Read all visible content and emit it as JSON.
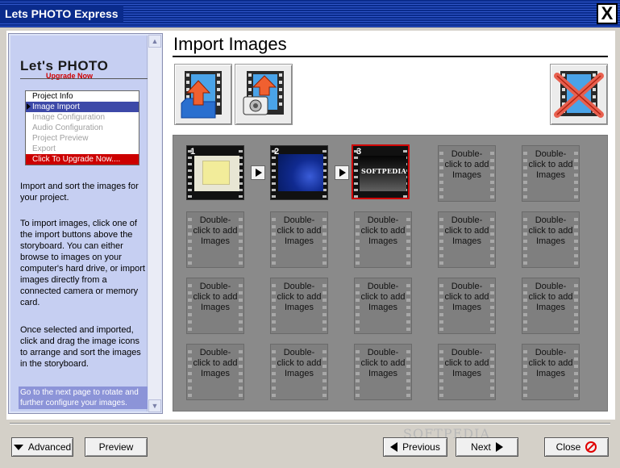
{
  "window": {
    "title": "Lets PHOTO Express",
    "close_glyph": "X"
  },
  "sidebar": {
    "logo_main": "Let's PHOTO",
    "logo_sub": "Upgrade Now",
    "nav": [
      {
        "label": "Project Info",
        "state": "head"
      },
      {
        "label": "Image Import",
        "state": "active"
      },
      {
        "label": "Image Configuration",
        "state": "disabled"
      },
      {
        "label": "Audio Configuration",
        "state": "disabled"
      },
      {
        "label": "Project Preview",
        "state": "disabled"
      },
      {
        "label": "Export",
        "state": "disabled"
      },
      {
        "label": "Click To Upgrade Now....",
        "state": "upgrade"
      }
    ],
    "para1": "Import and sort the images for your project.",
    "para2": "To import images, click one of the import buttons above the storyboard. You can either browse to images on your computer's hard drive, or import images directly from a connected camera or memory card.",
    "para3": "Once selected and imported, click and drag the image icons to arrange and sort the images in the storyboard.",
    "tip": "Go to the next page to rotate and further configure your images."
  },
  "main": {
    "title": "Import Images",
    "tools": [
      {
        "name": "import-folder-icon"
      },
      {
        "name": "import-camera-icon"
      },
      {
        "name": "delete-image-icon"
      }
    ],
    "storyboard": {
      "filled": [
        {
          "number": "1",
          "thumb": "yellow-note"
        },
        {
          "number": "2",
          "thumb": "blue-desktop"
        },
        {
          "number": "3",
          "thumb": "softpedia",
          "caption": "SOFTPEDIA",
          "selected": true
        }
      ],
      "empty_label": "Double-click to add Images",
      "columns": 5,
      "rows": 4
    }
  },
  "footer": {
    "advanced": "Advanced",
    "preview": "Preview",
    "previous": "Previous",
    "next": "Next",
    "close": "Close",
    "watermark": "SOFTPEDIA"
  },
  "colors": {
    "titlebar": "#0a2b8c",
    "sidebar": "#c6cff2",
    "active_nav": "#3d49a8",
    "upgrade": "#cc0000",
    "board": "#8a8a8a"
  }
}
